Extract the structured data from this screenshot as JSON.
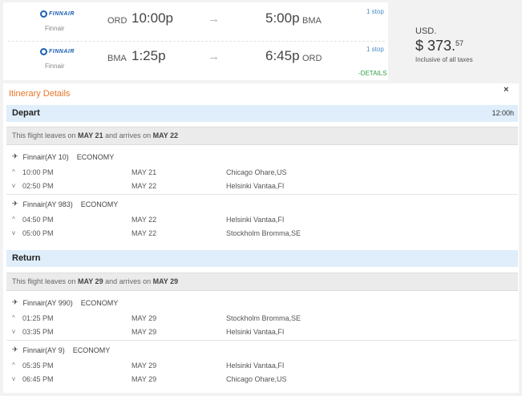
{
  "summary": {
    "legs": [
      {
        "airline_logo_text": "FINNAIR",
        "airline_name": "Finnair",
        "dep_code": "ORD",
        "dep_time": "10:00p",
        "arr_time": "5:00p",
        "arr_code": "BMA",
        "stops": "1 stop"
      },
      {
        "airline_logo_text": "FINNAIR",
        "airline_name": "Finnair",
        "dep_code": "BMA",
        "dep_time": "1:25p",
        "arr_time": "6:45p",
        "arr_code": "ORD",
        "stops": "1 stop"
      }
    ],
    "arrow_glyph": "→",
    "details_link": "-DETAILS"
  },
  "price": {
    "currency": "USD.",
    "amount": "$ 373.",
    "cents": "57",
    "note": "Inclusive of all taxes"
  },
  "itinerary": {
    "title": "Itinerary Details",
    "close_glyph": "×",
    "depart": {
      "label": "Depart",
      "duration": "12:00h",
      "info_prefix": "This flight leaves on ",
      "info_date1": "MAY 21",
      "info_mid": " and arrives on ",
      "info_date2": "MAY 22",
      "segments": [
        {
          "flight": "Finnair(AY 10)",
          "cabin": "ECONOMY",
          "dep": {
            "time": "10:00 PM",
            "date": "MAY 21",
            "city": "Chicago Ohare,US"
          },
          "arr": {
            "time": "02:50 PM",
            "date": "MAY 22",
            "city": "Helsinki Vantaa,FI"
          }
        },
        {
          "flight": "Finnair(AY 983)",
          "cabin": "ECONOMY",
          "dep": {
            "time": "04:50 PM",
            "date": "MAY 22",
            "city": "Helsinki Vantaa,FI"
          },
          "arr": {
            "time": "05:00 PM",
            "date": "MAY 22",
            "city": "Stockholm Bromma,SE"
          }
        }
      ]
    },
    "return": {
      "label": "Return",
      "info_prefix": "This flight leaves on ",
      "info_date1": "MAY 29",
      "info_mid": " and arrives on ",
      "info_date2": "MAY 29",
      "segments": [
        {
          "flight": "Finnair(AY 990)",
          "cabin": "ECONOMY",
          "dep": {
            "time": "01:25 PM",
            "date": "MAY 29",
            "city": "Stockholm Bromma,SE"
          },
          "arr": {
            "time": "03:35 PM",
            "date": "MAY 29",
            "city": "Helsinki Vantaa,FI"
          }
        },
        {
          "flight": "Finnair(AY 9)",
          "cabin": "ECONOMY",
          "dep": {
            "time": "05:35 PM",
            "date": "MAY 29",
            "city": "Helsinki Vantaa,FI"
          },
          "arr": {
            "time": "06:45 PM",
            "date": "MAY 29",
            "city": "Chicago Ohare,US"
          }
        }
      ]
    },
    "icons": {
      "plane": "plane-icon",
      "dep": "chevron-up-icon",
      "arr": "chevron-down-icon"
    }
  },
  "colors": {
    "accent_orange": "#e8752a",
    "link_blue": "#4a8ac7",
    "details_green": "#33a04a",
    "section_blue": "#dfeefa",
    "finnair_blue": "#1b5fb0"
  }
}
